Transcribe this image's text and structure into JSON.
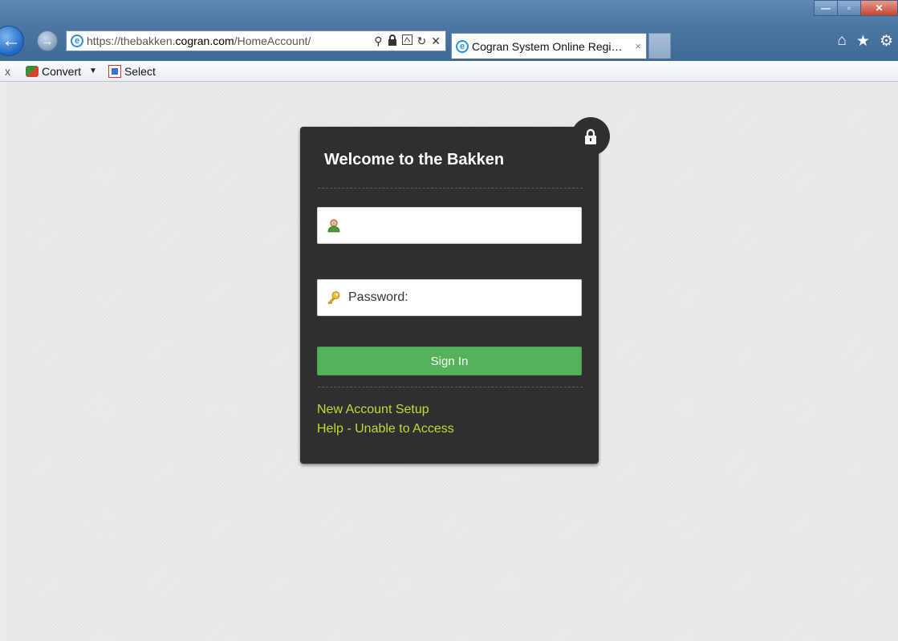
{
  "browser": {
    "address": {
      "url_prefix": "https://thebakken.",
      "url_domain": "cogran.com",
      "url_path": "/HomeAccount/"
    },
    "address_tools": {
      "search": "⚲",
      "lock": "🔒",
      "refresh": "↻",
      "stop": "✕"
    },
    "tab": {
      "title": "Cogran System Online Regi…",
      "close": "×"
    },
    "window_buttons": {
      "minimize": "—",
      "maximize": "▫",
      "close": "✕"
    },
    "command_bar": {
      "x": "x",
      "convert_label": "Convert",
      "select_label": "Select",
      "caret": "▼"
    },
    "right_icons": {
      "home": "⌂",
      "favorites": "★",
      "tools": "⚙"
    }
  },
  "login": {
    "title": "Welcome to the Bakken",
    "username_value": "",
    "password_placeholder": "Password:",
    "signin_label": "Sign In",
    "links": {
      "new_account": "New Account Setup",
      "help": "Help - Unable to Access"
    }
  },
  "colors": {
    "panel": "#2f2f31",
    "button": "#54b35a",
    "link": "#c8d930",
    "page_bg": "#ececec"
  }
}
